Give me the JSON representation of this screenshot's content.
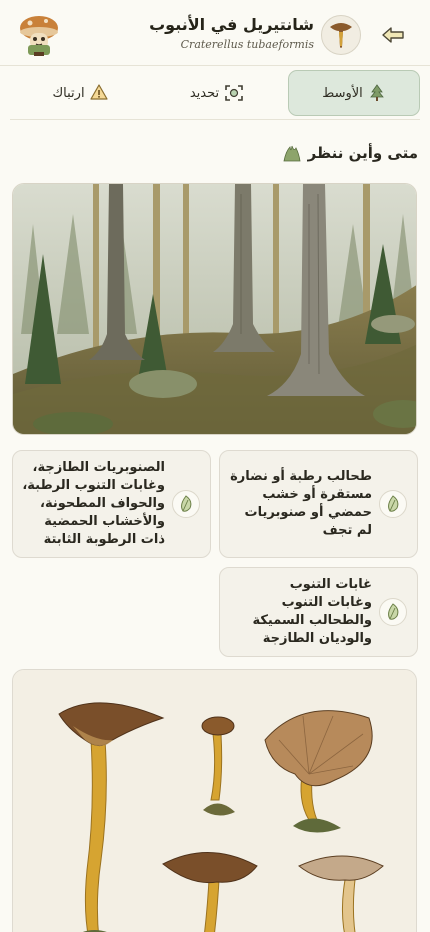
{
  "header": {
    "title": "شانتيريل في الأنبوب",
    "scientific_name": "Craterellus tubaeformis",
    "back_icon": "arrow-left-icon",
    "avatar_icon": "mushroom-icon",
    "mascot_icon": "mushroom-mascot-icon"
  },
  "tabs": [
    {
      "label": "الأوسط",
      "icon": "tree-icon",
      "active": true
    },
    {
      "label": "تحديد",
      "icon": "scan-icon",
      "active": false
    },
    {
      "label": "ارتباك",
      "icon": "warning-icon",
      "active": false
    }
  ],
  "section": {
    "title": "متى وأين ننظر",
    "icon": "moss-icon"
  },
  "habitats": [
    {
      "text": "طحالب رطبة أو نضارة مستقرة أو خشب حمضي أو صنوبريات لم تجف",
      "icon": "leaf-icon"
    },
    {
      "text": "الصنوبريات الطازجة، وغابات التنوب الرطبة، والحواف المطحونة، والأخشاب الحمضية ذات الرطوبة الثابتة",
      "icon": "leaf-icon"
    },
    {
      "text": "غابات التنوب وغابات التنوب والطحالب السميكة والوديان الطازجة",
      "icon": "leaf-icon"
    }
  ],
  "colors": {
    "background": "#fbfaf4",
    "accent": "#dde8dc",
    "card": "#f4f2ea",
    "mushroom_cap": "#7a4f2a",
    "mushroom_stem": "#d6a431"
  }
}
